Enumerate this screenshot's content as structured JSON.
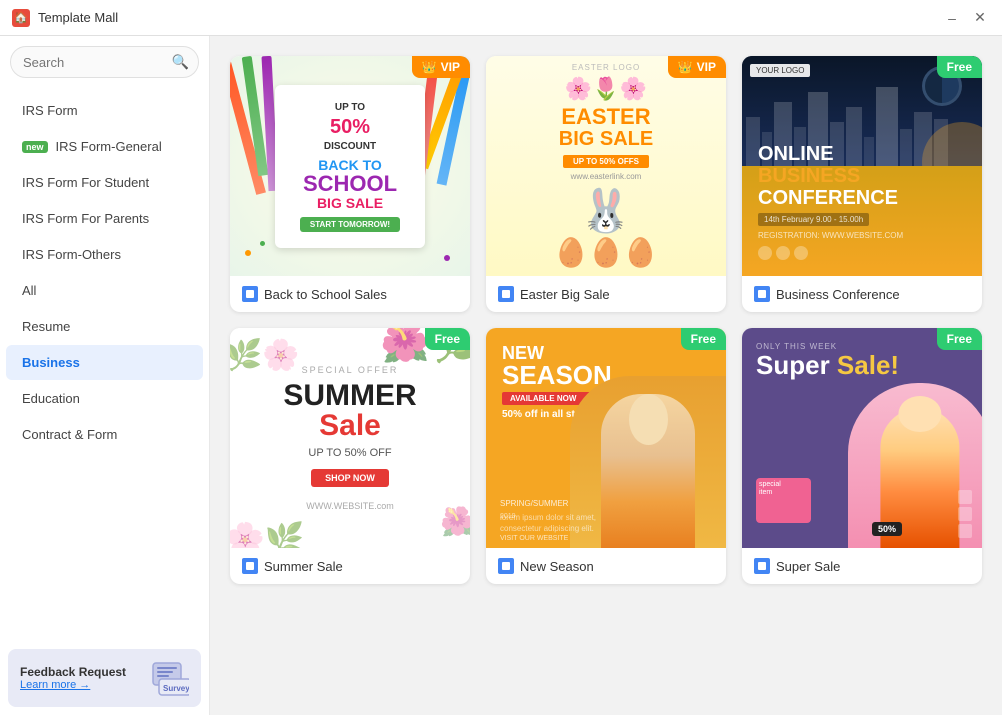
{
  "titleBar": {
    "appName": "Template Mall",
    "minimize": "–",
    "close": "✕"
  },
  "sidebar": {
    "searchPlaceholder": "Search",
    "navItems": [
      {
        "id": "irs-form",
        "label": "IRS Form",
        "active": false,
        "badge": null
      },
      {
        "id": "irs-form-general",
        "label": "IRS Form-General",
        "active": false,
        "badge": "new"
      },
      {
        "id": "irs-form-student",
        "label": "IRS Form For Student",
        "active": false,
        "badge": null
      },
      {
        "id": "irs-form-parents",
        "label": "IRS Form For Parents",
        "active": false,
        "badge": null
      },
      {
        "id": "irs-form-others",
        "label": "IRS Form-Others",
        "active": false,
        "badge": null
      },
      {
        "id": "all",
        "label": "All",
        "active": false,
        "badge": null
      },
      {
        "id": "resume",
        "label": "Resume",
        "active": false,
        "badge": null
      },
      {
        "id": "business",
        "label": "Business",
        "active": true,
        "badge": null
      },
      {
        "id": "education",
        "label": "Education",
        "active": false,
        "badge": null
      },
      {
        "id": "contract-form",
        "label": "Contract & Form",
        "active": false,
        "badge": null
      }
    ],
    "feedback": {
      "title": "Feedback Request",
      "link": "Learn more →"
    }
  },
  "cards": [
    {
      "id": "back-to-school",
      "label": "Back to School Sales",
      "badge": "VIP",
      "badgeType": "vip"
    },
    {
      "id": "easter-big-sale",
      "label": "Easter Big Sale",
      "badge": "VIP",
      "badgeType": "vip"
    },
    {
      "id": "business-conference",
      "label": "Business Conference",
      "badge": "Free",
      "badgeType": "free"
    },
    {
      "id": "summer-sale",
      "label": "Summer Sale",
      "badge": "Free",
      "badgeType": "free"
    },
    {
      "id": "new-season",
      "label": "New Season",
      "badge": "Free",
      "badgeType": "free"
    },
    {
      "id": "super-sale",
      "label": "Super Sale",
      "badge": "Free",
      "badgeType": "free"
    }
  ],
  "colors": {
    "accent": "#1a73e8",
    "activeNavBg": "#e8f0fe",
    "vipBadge": "#ff8c00",
    "freeBadge": "#2ecc71"
  }
}
